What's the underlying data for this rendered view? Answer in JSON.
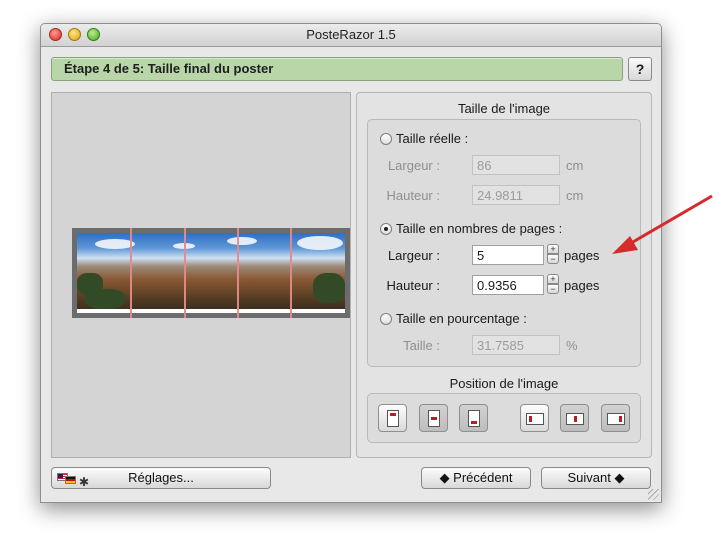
{
  "window": {
    "title": "PosteRazor 1.5"
  },
  "step": {
    "label": "Étape 4 de 5: Taille final du poster",
    "help_label": "?"
  },
  "image_size": {
    "title": "Taille de l'image",
    "real": {
      "label": "Taille réelle :",
      "width_label": "Largeur :",
      "width_value": "86",
      "width_unit": "cm",
      "height_label": "Hauteur :",
      "height_value": "24.9811",
      "height_unit": "cm"
    },
    "pages": {
      "label": "Taille en nombres de pages :",
      "width_label": "Largeur :",
      "width_value": "5",
      "width_unit": "pages",
      "height_label": "Hauteur :",
      "height_value": "0.9356",
      "height_unit": "pages",
      "stepper_up": "+",
      "stepper_down": "−"
    },
    "percent": {
      "label": "Taille en pourcentage :",
      "size_label": "Taille :",
      "size_value": "31.7585",
      "size_unit": "%"
    }
  },
  "image_position": {
    "title": "Position de l'image",
    "buttons": [
      "top",
      "center",
      "bottom",
      "left",
      "middle",
      "right"
    ]
  },
  "footer": {
    "settings_label": "Réglages...",
    "prev_label": "◆ Précédent",
    "next_label": "Suivant ◆"
  },
  "colors": {
    "stepbar": "#b8d6a8",
    "cut_lines": "#e68a8a",
    "annotation_arrow": "#d52b2b"
  }
}
